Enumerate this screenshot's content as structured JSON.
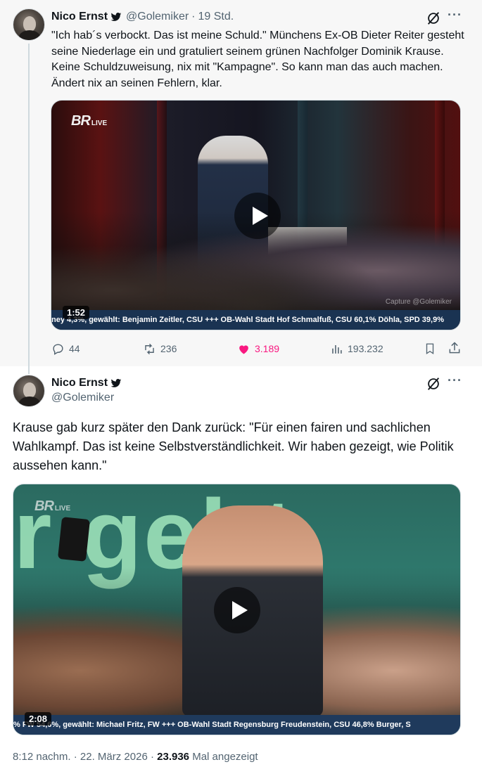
{
  "tweet1": {
    "author_name": "Nico Ernst",
    "handle": "@Golemiker",
    "separator": "·",
    "time": "19 Std.",
    "text": "\"Ich hab´s verbockt. Das ist meine Schuld.\" Münchens Ex-OB Dieter Reiter gesteht seine Niederlage ein und gratuliert seinem grünen Nachfolger Dominik Krause. Keine Schuldzuweisung, nix mit \"Kampagne\". So kann man das auch machen. Ändert nix an seinen Fehlern, klar.",
    "video": {
      "logo": "BR",
      "logo_suffix": "LIVE",
      "duration": "1:52",
      "ticker": "ney 4,3%, gewählt: Benjamin Zeitler, CSU +++ OB-Wahl Stadt Hof    Schmalfuß, CSU 60,1%    Döhla, SPD 39,9%",
      "watermark": "Capture @Golemiker"
    },
    "actions": {
      "replies": "44",
      "reposts": "236",
      "likes": "3.189",
      "views": "193.232"
    }
  },
  "tweet2": {
    "author_name": "Nico Ernst",
    "handle": "@Golemiker",
    "text": "Krause gab kurz später den Dank zurück: \"Für einen fairen und sachlichen Wahlkampf. Das ist keine Selbstverständlichkeit. Wir haben gezeigt, wie Politik aussehen kann.\"",
    "video": {
      "background_word": "r geht",
      "logo": "BR",
      "logo_suffix": "LIVE",
      "duration": "2:08",
      "ticker": "% FW 54,6%, gewählt: Michael Fritz, FW +++ OB-Wahl Stadt Regensburg    Freudenstein, CSU 46,8%    Burger, S"
    },
    "footer": {
      "time": "8:12 nachm.",
      "separator": "·",
      "date": "22. März 2026",
      "separator2": "·",
      "views": "23.936",
      "views_label": "Mal angezeigt"
    }
  },
  "colors": {
    "text": "#0f1419",
    "secondary": "#536471",
    "like": "#f91880",
    "verified": "#0f1419"
  }
}
